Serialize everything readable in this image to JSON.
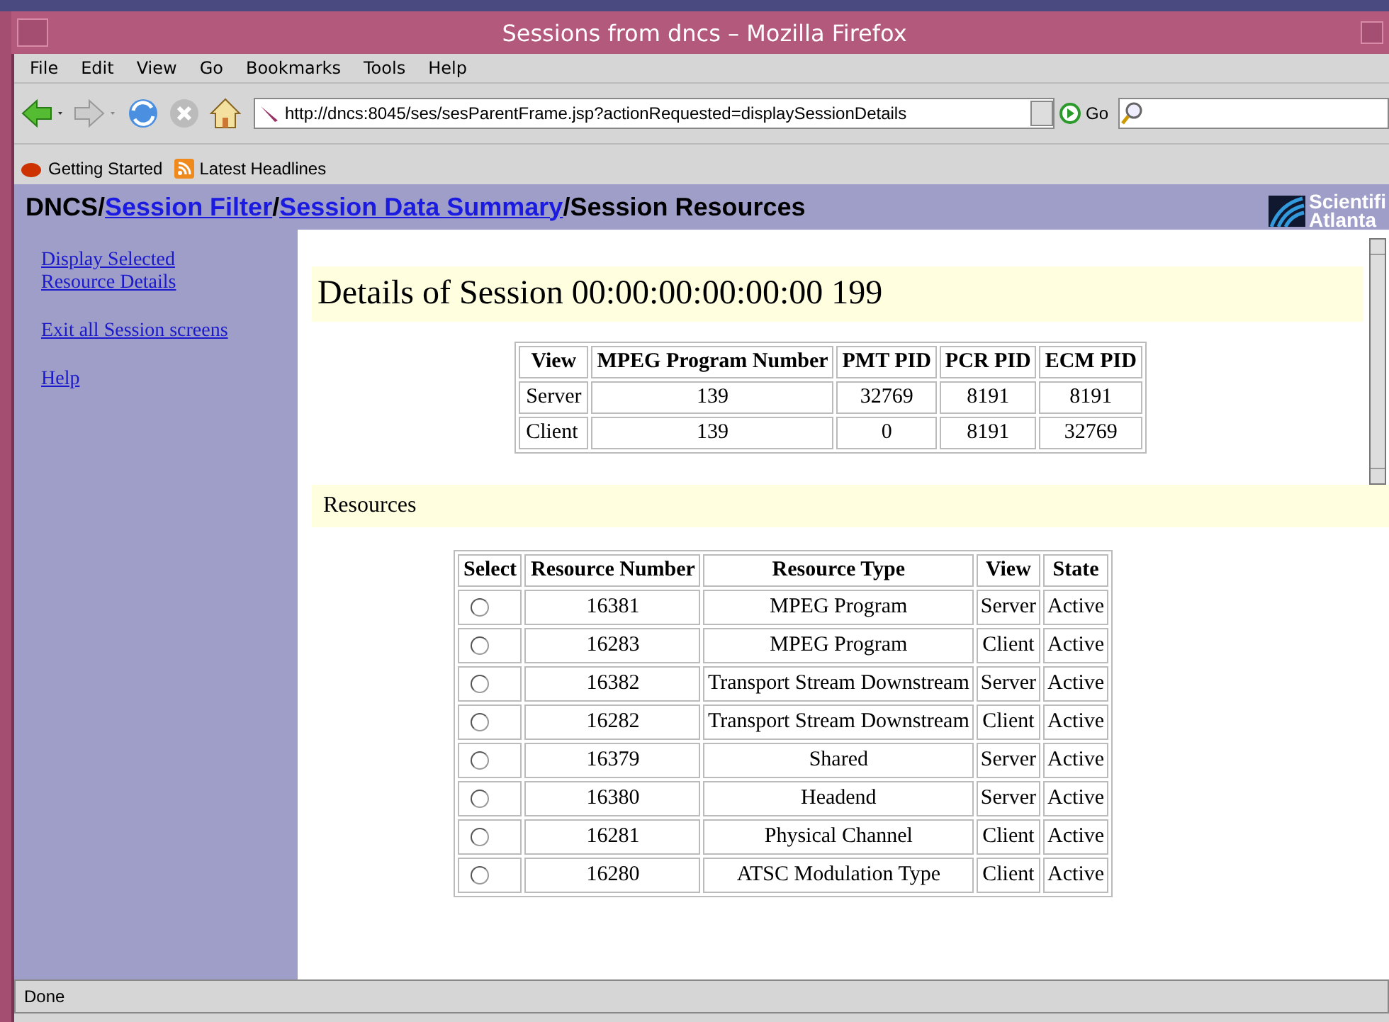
{
  "window": {
    "title": "Sessions from dncs – Mozilla Firefox"
  },
  "menu": [
    "File",
    "Edit",
    "View",
    "Go",
    "Bookmarks",
    "Tools",
    "Help"
  ],
  "toolbar": {
    "url": "http://dncs:8045/ses/sesParentFrame.jsp?actionRequested=displaySessionDetails",
    "go_label": "Go"
  },
  "bookmarks": [
    "Getting Started",
    "Latest Headlines"
  ],
  "breadcrumb": [
    {
      "label": "DNCS",
      "link": false
    },
    {
      "label": "/",
      "link": false
    },
    {
      "label": "Session Filter",
      "link": true
    },
    {
      "label": "/",
      "link": false
    },
    {
      "label": "Session Data Summary",
      "link": true
    },
    {
      "label": "/",
      "link": false
    },
    {
      "label": "Session Resources",
      "link": false
    }
  ],
  "logo": {
    "line1": "Scientifi",
    "line2": "Atlanta"
  },
  "sidebar": {
    "items": [
      "Display Selected Resource Details",
      "Exit all Session screens",
      "Help"
    ]
  },
  "details": {
    "heading": "Details of Session 00:00:00:00:00:00 199",
    "columns": [
      "View",
      "MPEG Program Number",
      "PMT PID",
      "PCR PID",
      "ECM PID"
    ],
    "rows": [
      [
        "Server",
        "139",
        "32769",
        "8191",
        "8191"
      ],
      [
        "Client",
        "139",
        "0",
        "8191",
        "32769"
      ]
    ]
  },
  "resources": {
    "heading": "Resources",
    "columns": [
      "Select",
      "Resource Number",
      "Resource Type",
      "View",
      "State"
    ],
    "rows": [
      {
        "selected": false,
        "cells": [
          "",
          "16381",
          "MPEG Program",
          "Server",
          "Active"
        ]
      },
      {
        "selected": false,
        "cells": [
          "",
          "16283",
          "MPEG Program",
          "Client",
          "Active"
        ]
      },
      {
        "selected": false,
        "cells": [
          "",
          "16382",
          "Transport Stream Downstream",
          "Server",
          "Active"
        ]
      },
      {
        "selected": false,
        "cells": [
          "",
          "16282",
          "Transport Stream Downstream",
          "Client",
          "Active"
        ]
      },
      {
        "selected": false,
        "cells": [
          "",
          "16379",
          "Shared",
          "Server",
          "Active"
        ]
      },
      {
        "selected": false,
        "cells": [
          "",
          "16380",
          "Headend",
          "Server",
          "Active"
        ]
      },
      {
        "selected": false,
        "cells": [
          "",
          "16281",
          "Physical Channel",
          "Client",
          "Active"
        ]
      },
      {
        "selected": false,
        "cells": [
          "",
          "16280",
          "ATSC Modulation Type",
          "Client",
          "Active"
        ]
      }
    ]
  },
  "status_bar": {
    "text": "Done"
  }
}
